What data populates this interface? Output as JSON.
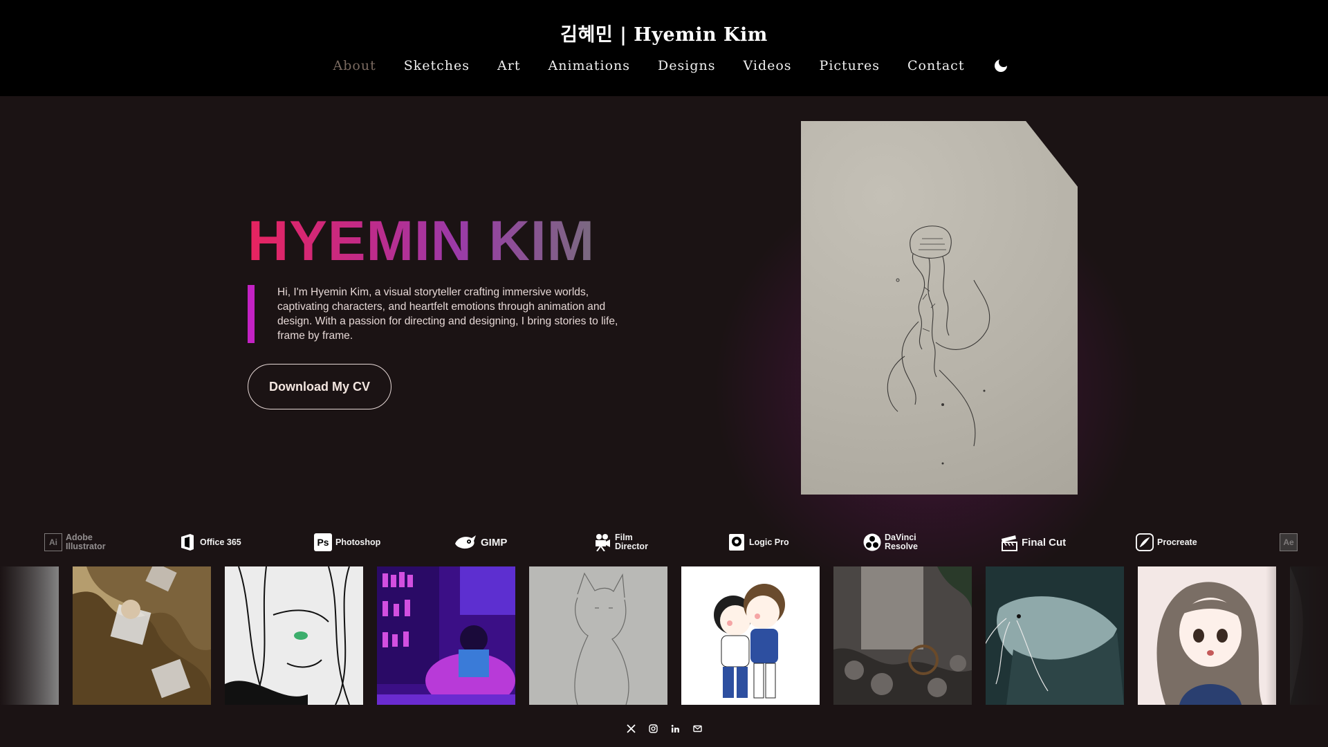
{
  "header": {
    "title": "김혜민 | Hyemin Kim",
    "nav": [
      "About",
      "Sketches",
      "Art",
      "Animations",
      "Designs",
      "Videos",
      "Pictures",
      "Contact"
    ],
    "active_nav": "About",
    "theme_icon": "moon-icon"
  },
  "hero": {
    "name": "HYEMIN KIM",
    "bio": "Hi, I'm Hyemin Kim, a visual storyteller crafting immersive worlds, captivating characters, and heartfelt emotions through animation and design. With a passion for directing and designing, I bring stories to life, frame by frame.",
    "cv_button": "Download My CV",
    "accent_color": "#c322c4",
    "gradient_colors": [
      "#e8245f",
      "#c02b8a",
      "#9b3aa8",
      "#7a6a80"
    ]
  },
  "tools": [
    {
      "label": "Adobe Illustrator",
      "icon": "illustrator-icon",
      "glyph": "Ai"
    },
    {
      "label": "Office 365",
      "icon": "office-icon",
      "glyph": ""
    },
    {
      "label": "Photoshop",
      "icon": "photoshop-icon",
      "glyph": "Ps"
    },
    {
      "label": "GIMP",
      "icon": "gimp-icon",
      "glyph": ""
    },
    {
      "label": "Film Director",
      "icon": "film-camera-icon",
      "glyph": ""
    },
    {
      "label": "Logic Pro",
      "icon": "logic-pro-icon",
      "glyph": ""
    },
    {
      "label": "DaVinci Resolve",
      "icon": "davinci-resolve-icon",
      "glyph": ""
    },
    {
      "label": "Final Cut",
      "icon": "clapperboard-icon",
      "glyph": ""
    },
    {
      "label": "Procreate",
      "icon": "procreate-icon",
      "glyph": ""
    },
    {
      "label": "",
      "icon": "after-effects-icon",
      "glyph": "Ae"
    }
  ],
  "gallery": [
    {
      "name": "thumb-gray-partial",
      "colors": [
        "#8a8a8a",
        "#3a3a3a"
      ]
    },
    {
      "name": "thumb-golden-ice",
      "colors": [
        "#b39a6a",
        "#5a4322"
      ]
    },
    {
      "name": "thumb-ink-portrait",
      "colors": [
        "#e9e9e9",
        "#222222"
      ]
    },
    {
      "name": "thumb-purple-library",
      "colors": [
        "#6a2bd0",
        "#2a0d5a"
      ]
    },
    {
      "name": "thumb-cat-sketch",
      "colors": [
        "#bdbdbb",
        "#a8a8a6"
      ]
    },
    {
      "name": "thumb-couple-cartoon",
      "colors": [
        "#ffffff",
        "#f3f3f3"
      ]
    },
    {
      "name": "thumb-stone-waterwheel",
      "colors": [
        "#5d5a57",
        "#2f2c2a"
      ]
    },
    {
      "name": "thumb-catfish",
      "colors": [
        "#3a5a5e",
        "#152526"
      ]
    },
    {
      "name": "thumb-girl-portrait",
      "colors": [
        "#f5e9e8",
        "#9a8d84"
      ]
    },
    {
      "name": "thumb-dark-partial",
      "colors": [
        "#2a2a2a",
        "#151515"
      ]
    }
  ],
  "socials": [
    {
      "name": "x-icon",
      "glyph": "𝕏"
    },
    {
      "name": "instagram-icon",
      "glyph": ""
    },
    {
      "name": "linkedin-icon",
      "glyph": "in"
    },
    {
      "name": "email-icon",
      "glyph": ""
    }
  ]
}
